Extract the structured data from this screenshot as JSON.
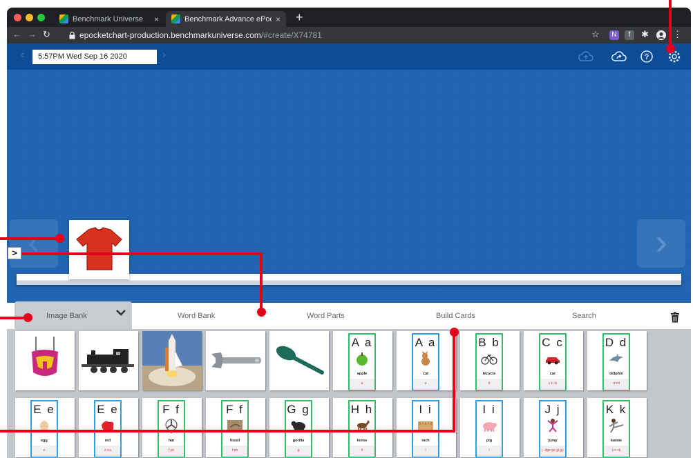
{
  "browser": {
    "tabs": [
      {
        "label": "Benchmark Universe",
        "close": "×"
      },
      {
        "label": "Benchmark Advance ePocket C",
        "close": "×"
      }
    ],
    "new_tab": "+",
    "url_host": "epocketchart-production.benchmarkuniverse.com",
    "url_path": "/#create/X74781"
  },
  "toolbar": {
    "datetime": "5:57PM Wed Sep 16 2020"
  },
  "panel": {
    "tabs": [
      "Image Bank",
      "Word Bank",
      "Word Parts",
      "Build Cards",
      "Search"
    ],
    "active_tab": "Image Bank"
  },
  "collapse_label": ">",
  "image_cards": [
    "baby-swing",
    "train",
    "space-shuttle",
    "wrench",
    "spoon"
  ],
  "letter_cards_row1": [
    {
      "letters": "A a",
      "word": "apple",
      "foot": "a",
      "border": "green"
    },
    {
      "letters": "A a",
      "word": "cat",
      "foot": "a",
      "border": "blue"
    },
    {
      "letters": "B b",
      "word": "bicycle",
      "foot": "b",
      "border": "green"
    },
    {
      "letters": "C c",
      "word": "car",
      "foot": "c k ck",
      "border": "green"
    },
    {
      "letters": "D d",
      "word": "dolphin",
      "foot": "d ed",
      "border": "green"
    }
  ],
  "letter_cards_row2": [
    {
      "letters": "E e",
      "word": "egg",
      "foot": "e",
      "border": "blue"
    },
    {
      "letters": "E e",
      "word": "red",
      "foot": "e ea",
      "border": "blue"
    },
    {
      "letters": "F f",
      "word": "fan",
      "foot": "f ph",
      "border": "green"
    },
    {
      "letters": "F f",
      "word": "fossil",
      "foot": "f ph",
      "border": "green"
    },
    {
      "letters": "G g",
      "word": "gorilla",
      "foot": "g",
      "border": "green"
    },
    {
      "letters": "H h",
      "word": "horse",
      "foot": "h",
      "border": "green"
    },
    {
      "letters": "I i",
      "word": "inch",
      "foot": "i",
      "border": "blue"
    },
    {
      "letters": "I i",
      "word": "pig",
      "foot": "i",
      "border": "blue"
    },
    {
      "letters": "J j",
      "word": "jump",
      "foot": "j -dge ge gi gy",
      "border": "blue"
    },
    {
      "letters": "K k",
      "word": "karate",
      "foot": "k c ck",
      "border": "green"
    }
  ],
  "colors": {
    "app_blue": "#1f64b2",
    "topbar": "#0d4d97",
    "callout_red": "#e4001b",
    "border_blue": "#2f9fe0",
    "border_green": "#2fbf6a"
  }
}
